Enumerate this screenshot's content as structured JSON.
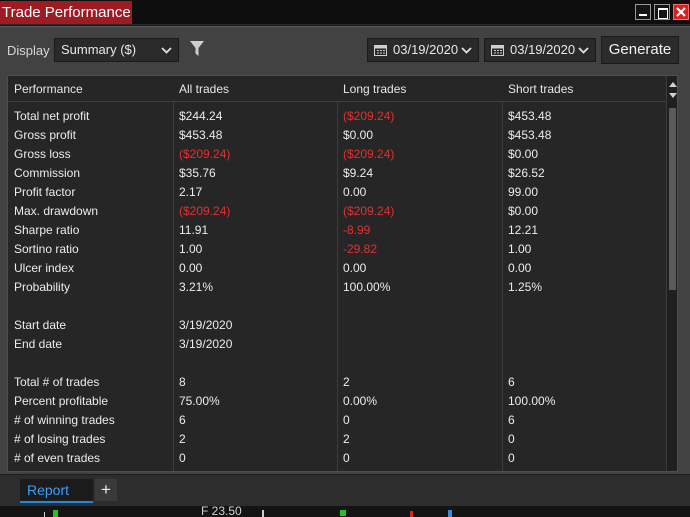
{
  "window": {
    "title": "Trade Performance"
  },
  "toolbar": {
    "display_label": "Display",
    "display_value": "Summary ($)",
    "start_date": "03/19/2020",
    "end_date": "03/19/2020",
    "generate_label": "Generate"
  },
  "table": {
    "headers": [
      "Performance",
      "All trades",
      "Long trades",
      "Short trades"
    ],
    "rows": [
      {
        "label": "Total net profit",
        "all": "$244.24",
        "long": "($209.24)",
        "short": "$453.48",
        "neg": [
          false,
          true,
          false
        ]
      },
      {
        "label": "Gross profit",
        "all": "$453.48",
        "long": "$0.00",
        "short": "$453.48",
        "neg": [
          false,
          false,
          false
        ]
      },
      {
        "label": "Gross loss",
        "all": "($209.24)",
        "long": "($209.24)",
        "short": "$0.00",
        "neg": [
          true,
          true,
          false
        ]
      },
      {
        "label": "Commission",
        "all": "$35.76",
        "long": "$9.24",
        "short": "$26.52",
        "neg": [
          false,
          false,
          false
        ]
      },
      {
        "label": "Profit factor",
        "all": "2.17",
        "long": "0.00",
        "short": "99.00",
        "neg": [
          false,
          false,
          false
        ]
      },
      {
        "label": "Max. drawdown",
        "all": "($209.24)",
        "long": "($209.24)",
        "short": "$0.00",
        "neg": [
          true,
          true,
          false
        ]
      },
      {
        "label": "Sharpe ratio",
        "all": "11.91",
        "long": "-8.99",
        "short": "12.21",
        "neg": [
          false,
          true,
          false
        ]
      },
      {
        "label": "Sortino ratio",
        "all": "1.00",
        "long": "-29.82",
        "short": "1.00",
        "neg": [
          false,
          true,
          false
        ]
      },
      {
        "label": "Ulcer index",
        "all": "0.00",
        "long": "0.00",
        "short": "0.00",
        "neg": [
          false,
          false,
          false
        ]
      },
      {
        "label": "Probability",
        "all": "3.21%",
        "long": "100.00%",
        "short": "1.25%",
        "neg": [
          false,
          false,
          false
        ]
      },
      {
        "label": "",
        "all": "",
        "long": "",
        "short": "",
        "neg": [
          false,
          false,
          false
        ]
      },
      {
        "label": "Start date",
        "all": "3/19/2020",
        "long": "",
        "short": "",
        "neg": [
          false,
          false,
          false
        ]
      },
      {
        "label": "End date",
        "all": "3/19/2020",
        "long": "",
        "short": "",
        "neg": [
          false,
          false,
          false
        ]
      },
      {
        "label": "",
        "all": "",
        "long": "",
        "short": "",
        "neg": [
          false,
          false,
          false
        ]
      },
      {
        "label": "Total # of trades",
        "all": "8",
        "long": "2",
        "short": "6",
        "neg": [
          false,
          false,
          false
        ]
      },
      {
        "label": "Percent profitable",
        "all": "75.00%",
        "long": "0.00%",
        "short": "100.00%",
        "neg": [
          false,
          false,
          false
        ]
      },
      {
        "label": "# of winning trades",
        "all": "6",
        "long": "0",
        "short": "6",
        "neg": [
          false,
          false,
          false
        ]
      },
      {
        "label": "# of losing trades",
        "all": "2",
        "long": "2",
        "short": "0",
        "neg": [
          false,
          false,
          false
        ]
      },
      {
        "label": "# of even trades",
        "all": "0",
        "long": "0",
        "short": "0",
        "neg": [
          false,
          false,
          false
        ]
      }
    ]
  },
  "tabs": {
    "active_label": "Report",
    "add_label": "+"
  },
  "background": {
    "price_text": "F 23.50"
  },
  "colors": {
    "title_bg": "#9e1b24",
    "negative": "#e33030",
    "tab_active": "#3aa0ff",
    "close_btn": "#d72020"
  },
  "icons": [
    "minimize-icon",
    "maximize-icon",
    "close-icon",
    "chevron-down-icon",
    "filter-icon",
    "calendar-icon",
    "scroll-up-icon",
    "scroll-down-icon"
  ]
}
